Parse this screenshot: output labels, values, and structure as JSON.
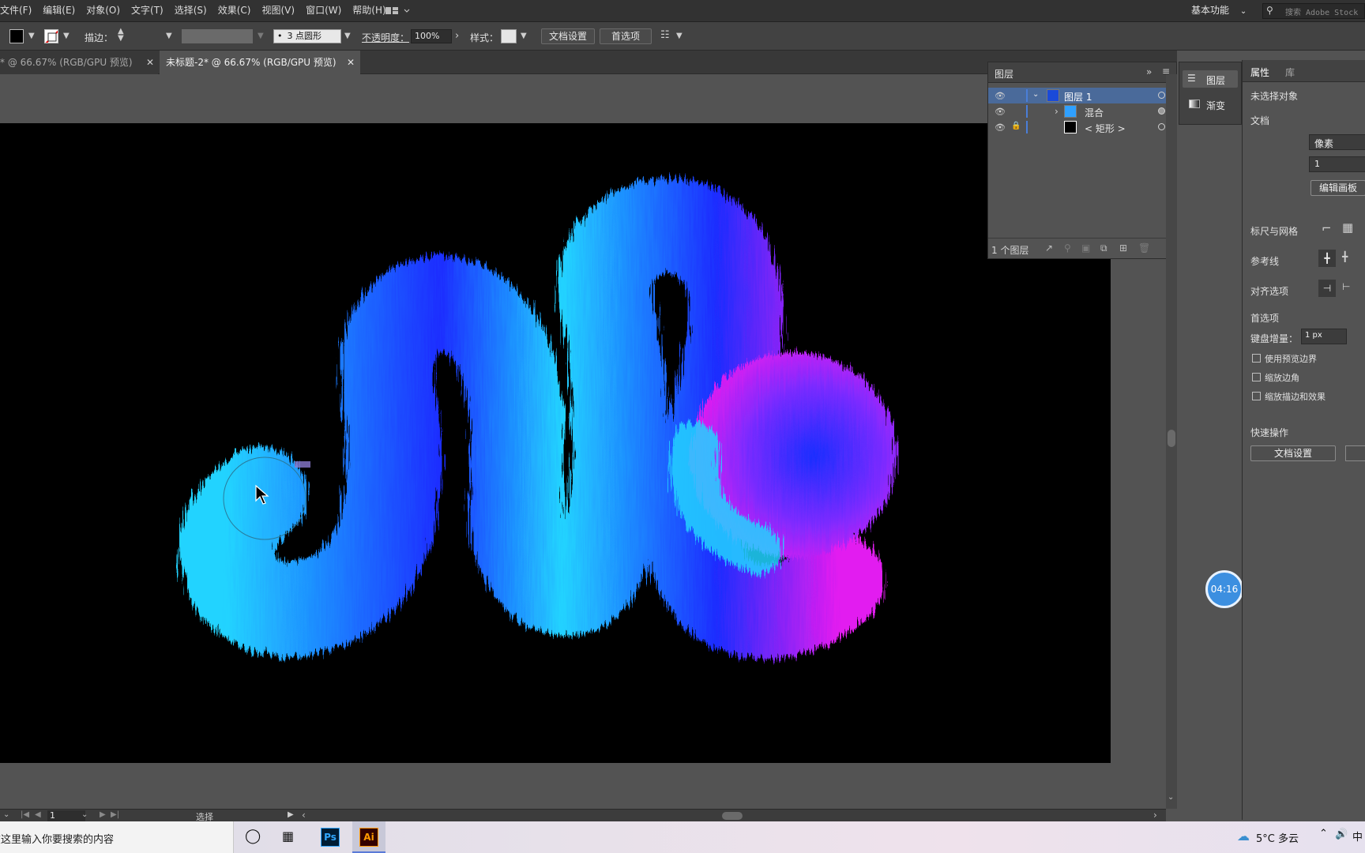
{
  "menubar": {
    "items": [
      "文件(F)",
      "编辑(E)",
      "对象(O)",
      "文字(T)",
      "选择(S)",
      "效果(C)",
      "视图(V)",
      "窗口(W)",
      "帮助(H)"
    ],
    "workspace": "基本功能",
    "stock_search_placeholder": "搜索 Adobe Stock"
  },
  "controlbar": {
    "stroke_label": "描边：",
    "brush_label": "3 点圆形",
    "opacity_label": "不透明度：",
    "opacity_value": "100%",
    "style_label": "样式：",
    "doc_setup_btn": "文档设置",
    "prefs_btn": "首选项"
  },
  "tabs": [
    {
      "label": "* @ 66.67% (RGB/GPU 预览)",
      "active": false
    },
    {
      "label": "未标题-2* @ 66.67% (RGB/GPU 预览)",
      "active": true
    }
  ],
  "layers_panel": {
    "title": "图层",
    "rows": [
      {
        "name": "图层 1",
        "selected": true
      },
      {
        "name": "混合",
        "selected": false
      },
      {
        "name": "< 矩形 >",
        "selected": false
      }
    ],
    "footer": "1 个图层"
  },
  "minidock": {
    "layers": "图层",
    "gradient": "渐变"
  },
  "properties": {
    "tab_props": "属性",
    "tab_lib": "库",
    "no_selection": "未选择对象",
    "document": "文档",
    "units_value": "像素",
    "artboard_value": "1",
    "edit_artboard_btn": "编辑画板",
    "ruler_grid": "标尺与网格",
    "guides": "参考线",
    "align_options": "对齐选项",
    "preferences": "首选项",
    "keyboard_increment_label": "键盘增量：",
    "keyboard_increment_value": "1 px",
    "use_preview_bounds": "使用预览边界",
    "scale_corners": "缩放边角",
    "scale_strokes": "缩放描边和效果",
    "quick_actions": "快速操作",
    "doc_setup_btn": "文档设置"
  },
  "canvas": {
    "timer": "04:16"
  },
  "statusbar": {
    "page": "1",
    "tool": "选择"
  },
  "ime": {
    "lang": "中"
  },
  "taskbar": {
    "search_placeholder": "在这里输入你要搜索的内容",
    "ps": "Ps",
    "ai": "Ai",
    "weather": "5°C 多云"
  },
  "colors": {
    "accent_blue": "#4a7ed8",
    "fur_cyan": "#22d3ff",
    "fur_blue": "#1a2dff",
    "fur_magenta": "#e21cf0"
  }
}
